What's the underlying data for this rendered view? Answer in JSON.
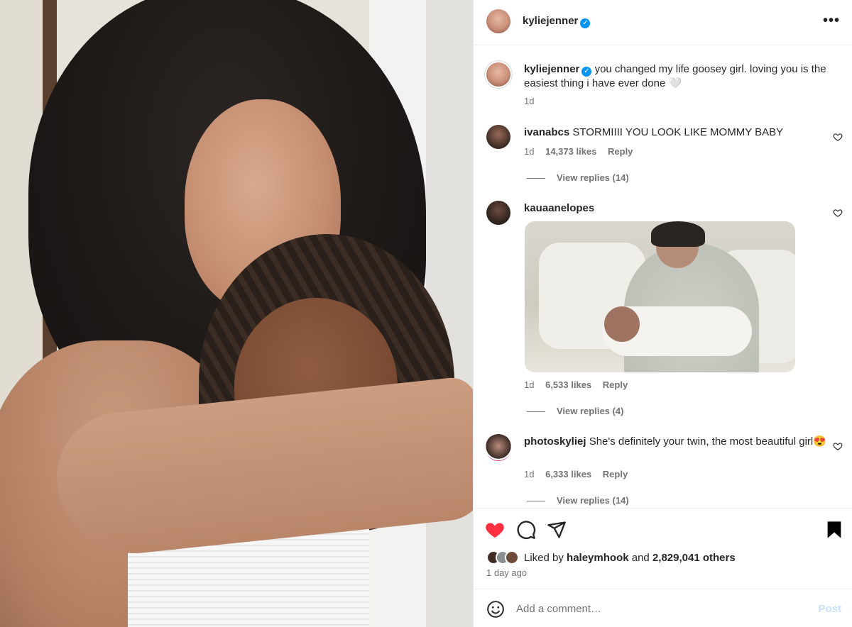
{
  "post": {
    "author": "kyliejenner",
    "verified_glyph": "✓",
    "more_glyph": "•••"
  },
  "caption": {
    "author": "kyliejenner",
    "text": "you changed my life goosey girl. loving you is the easiest thing i have ever done 🤍",
    "time": "1d"
  },
  "comments": [
    {
      "author": "ivanabcs",
      "text": "STORMIIII YOU LOOK LIKE MOMMY BABY",
      "time": "1d",
      "likes": "14,373 likes",
      "reply": "Reply",
      "view_replies": "View replies (14)"
    },
    {
      "author": "kauaanelopes",
      "text": "",
      "time": "1d",
      "likes": "6,533 likes",
      "reply": "Reply",
      "view_replies": "View replies (4)"
    },
    {
      "author": "photoskyliej",
      "text": "She's definitely your twin, the most beautiful girl😍",
      "time": "1d",
      "likes": "6,333 likes",
      "reply": "Reply",
      "view_replies": "View replies (14)"
    }
  ],
  "liked_by": {
    "prefix": "Liked by",
    "user": "haleymhook",
    "and": "and",
    "others": "2,829,041 others"
  },
  "time_ago": "1 day ago",
  "add_comment": {
    "placeholder": "Add a comment…",
    "post_label": "Post"
  },
  "colors": {
    "like_red": "#ff3040",
    "verified_blue": "#0095f6",
    "post_disabled": "#c7e0fd"
  }
}
